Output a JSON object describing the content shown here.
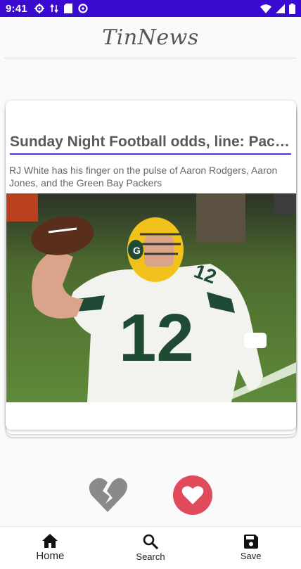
{
  "status_bar": {
    "time": "9:41",
    "left_icons": [
      "settings-icon",
      "data-transfer-icon",
      "sd-card-icon",
      "vpn-icon"
    ],
    "right_icons": [
      "wifi-icon",
      "cellular-signal-icon",
      "battery-icon"
    ],
    "background": "#3a0ad1"
  },
  "app": {
    "title": "TinNews"
  },
  "card": {
    "title": "Sunday Night Football odds, line: Pack...",
    "description": "RJ White has his finger on the pulse of Aaron Rodgers, Aaron Jones, and the Green Bay Packers",
    "image_icon": "football-player-photo",
    "accent": "#5a2bd8"
  },
  "actions": {
    "dislike_icon": "broken-heart-icon",
    "like_icon": "heart-icon",
    "like_color": "#e04a5a",
    "dislike_color": "#8a8a8a"
  },
  "bottom_nav": {
    "items": [
      {
        "label": "Home",
        "icon": "home-icon"
      },
      {
        "label": "Search",
        "icon": "search-icon"
      },
      {
        "label": "Save",
        "icon": "save-icon"
      }
    ],
    "active": "Home"
  }
}
